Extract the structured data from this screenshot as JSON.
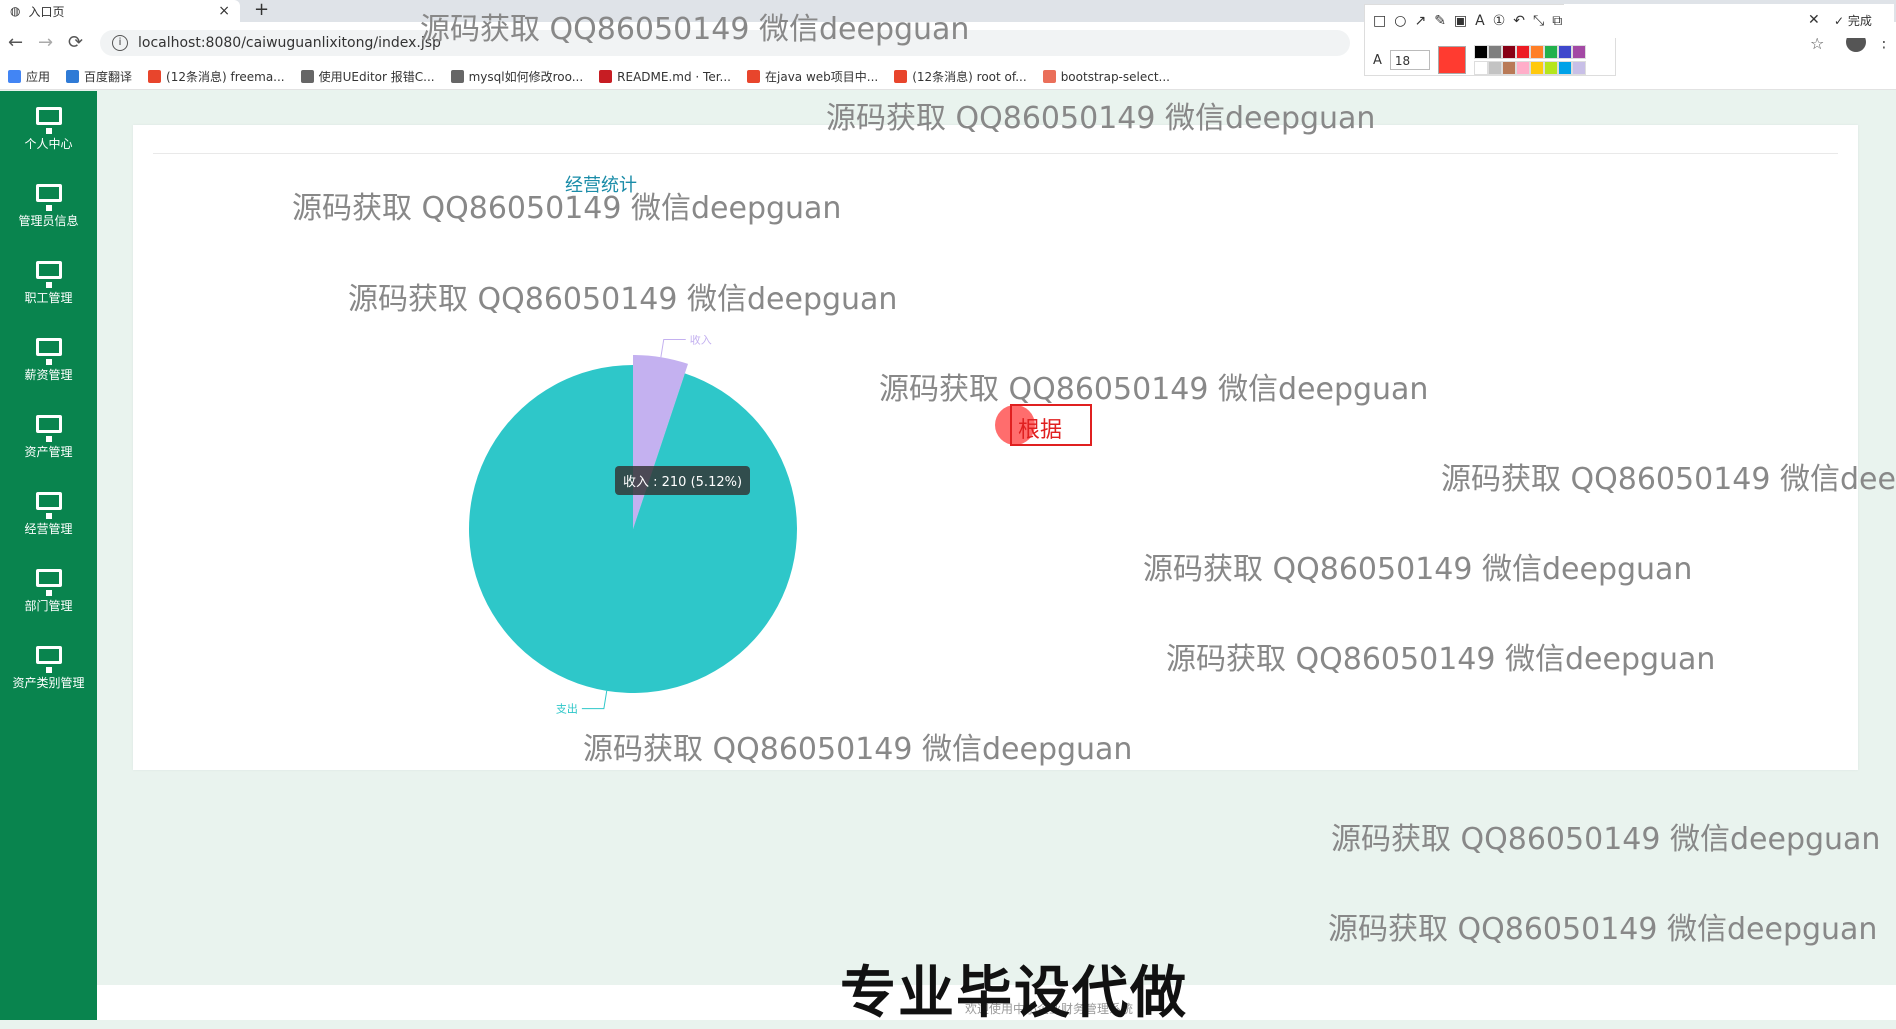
{
  "browser": {
    "tab_title": "入口页",
    "close_glyph": "×",
    "new_tab_glyph": "+",
    "back_glyph": "←",
    "forward_glyph": "→",
    "reload_glyph": "⟳",
    "url": "localhost:8080/caiwuguanlixitong/index.jsp",
    "star_glyph": "☆",
    "more_glyph": "⋮",
    "bookmarks": [
      {
        "label": "应用",
        "icon": "apps-icon",
        "color": "#4285f4"
      },
      {
        "label": "百度翻译",
        "icon": "baidu-translate-icon",
        "color": "#2f7bd6"
      },
      {
        "label": "(12条消息) freema...",
        "icon": "csdn-icon",
        "color": "#e8452c"
      },
      {
        "label": "使用UEditor 报错C...",
        "icon": "site-icon",
        "color": "#666666"
      },
      {
        "label": "mysql如何修改roo...",
        "icon": "site-icon",
        "color": "#666666"
      },
      {
        "label": "README.md · Ter...",
        "icon": "gitee-icon",
        "color": "#c71d23"
      },
      {
        "label": "在java web项目中...",
        "icon": "csdn-icon",
        "color": "#e8452c"
      },
      {
        "label": "(12条消息) root of...",
        "icon": "csdn-icon",
        "color": "#e8452c"
      },
      {
        "label": "bootstrap-select...",
        "icon": "jianshu-icon",
        "color": "#ea6f5a"
      }
    ]
  },
  "capture_toolbar": {
    "tools": [
      "□",
      "○",
      "↗",
      "✎",
      "▣",
      "A",
      "①",
      "↶",
      "⤡",
      "⧉",
      "⤢",
      "✕",
      "◉",
      "⤓",
      "▯",
      "⛉"
    ],
    "close_glyph": "✕",
    "done_label": "完成",
    "font_size": "18",
    "current_color": "#ff3b30",
    "palette": [
      "#000000",
      "#7f7f7f",
      "#880015",
      "#ed1c24",
      "#ff7f27",
      "#22b14c",
      "#3f48cc",
      "#a349a4",
      "#ffffff",
      "#c3c3c3",
      "#b97a57",
      "#ffaec9",
      "#ffc90e",
      "#b5e61d",
      "#00a2e8",
      "#c8bfe7"
    ]
  },
  "sidebar": {
    "items": [
      {
        "label": "个人中心",
        "icon": "monitor-icon"
      },
      {
        "label": "管理员信息",
        "icon": "monitor-icon"
      },
      {
        "label": "职工管理",
        "icon": "monitor-icon"
      },
      {
        "label": "薪资管理",
        "icon": "monitor-icon"
      },
      {
        "label": "资产管理",
        "icon": "monitor-icon"
      },
      {
        "label": "经营管理",
        "icon": "monitor-icon"
      },
      {
        "label": "部门管理",
        "icon": "monitor-icon"
      },
      {
        "label": "资产类别管理",
        "icon": "monitor-icon"
      }
    ]
  },
  "main": {
    "card_title": "经营统计",
    "tooltip": "收入 : 210 (5.12%)",
    "annotation_text": "根据",
    "footer_text": "欢迎使用中小企业财务管理系统"
  },
  "chart_data": {
    "type": "pie",
    "title": "",
    "slices": [
      {
        "name": "收入",
        "value": 210,
        "percent": 5.12,
        "color": "#c4b1f0"
      },
      {
        "name": "支出",
        "value": 3892,
        "percent": 94.88,
        "color": "#2ec7c9"
      }
    ]
  },
  "overlay": {
    "watermark": "源码获取 QQ86050149 微信deepguan",
    "caption": "专业毕设代做"
  }
}
